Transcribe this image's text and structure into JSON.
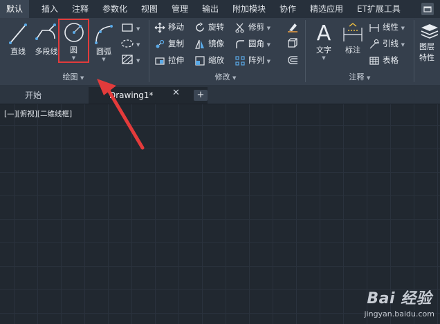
{
  "menu": [
    "默认",
    "插入",
    "注释",
    "参数化",
    "视图",
    "管理",
    "输出",
    "附加模块",
    "协作",
    "精选应用",
    "ET扩展工具"
  ],
  "draw_panel": {
    "line": "直线",
    "polyline": "多段线",
    "circle": "圆",
    "arc": "圆弧",
    "footer": "绘图"
  },
  "modify_panel": {
    "move": "移动",
    "rotate": "旋转",
    "trim": "修剪",
    "copy": "复制",
    "mirror": "镜像",
    "fillet": "圆角",
    "stretch": "拉伸",
    "scale": "缩放",
    "array": "阵列",
    "footer": "修改"
  },
  "annotation_panel": {
    "text": "文字",
    "dimension": "标注",
    "linear": "线性",
    "leader": "引线",
    "table": "表格",
    "footer": "注释"
  },
  "layer_panel": {
    "layer_properties": "图层特性"
  },
  "tabs": {
    "start": "开始",
    "drawing": "Drawing1*",
    "close": "✕",
    "add": "+"
  },
  "viewport_label": "[—][俯视][二维线框]",
  "watermark": {
    "logo": "Bai 经验",
    "url": "jingyan.baidu.com"
  },
  "colors": {
    "highlight": "#e33b3b",
    "arrow": "#e33b3b",
    "ribbon": "#353f4c",
    "canvas": "#212830"
  }
}
